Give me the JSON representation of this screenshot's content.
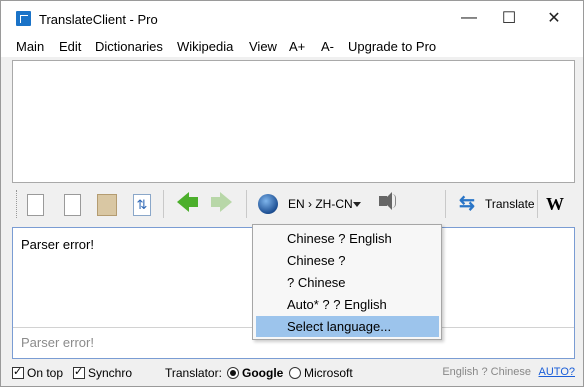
{
  "window": {
    "title": "TranslateClient - Pro",
    "controls": {
      "minimize": "—",
      "maximize": "☐",
      "close": "✕"
    }
  },
  "menu": [
    "Main",
    "Edit",
    "Dictionaries",
    "Wikipedia",
    "View",
    "A+",
    "A-",
    "Upgrade to Pro"
  ],
  "toolbar": {
    "language_pair": "EN › ZH-CN",
    "translate_label": "Translate",
    "wiki_label": "W",
    "icons": [
      "new-document-icon",
      "copy-icon",
      "paste-icon",
      "refresh-icon",
      "back-arrow-icon",
      "forward-arrow-icon",
      "globe-icon",
      "speaker-icon",
      "translate-icon",
      "wikipedia-icon"
    ]
  },
  "result": {
    "text": "Parser error!",
    "placeholder": "Parser error!"
  },
  "dropdown": {
    "items": [
      "Chinese ? English",
      "Chinese ?",
      " ? Chinese",
      "Auto* ?  ? English",
      "Select language..."
    ],
    "selected_index": 4,
    "highlight_color": "#9cc4ec"
  },
  "status": {
    "on_top_label": "On top",
    "on_top_checked": true,
    "synchro_label": "Synchro",
    "synchro_checked": true,
    "translator_label": "Translator:",
    "engine_options": [
      "Google",
      "Microsoft"
    ],
    "engine_selected": "Google",
    "pair_text": "English ? Chinese",
    "auto_link": "AUTO?"
  }
}
